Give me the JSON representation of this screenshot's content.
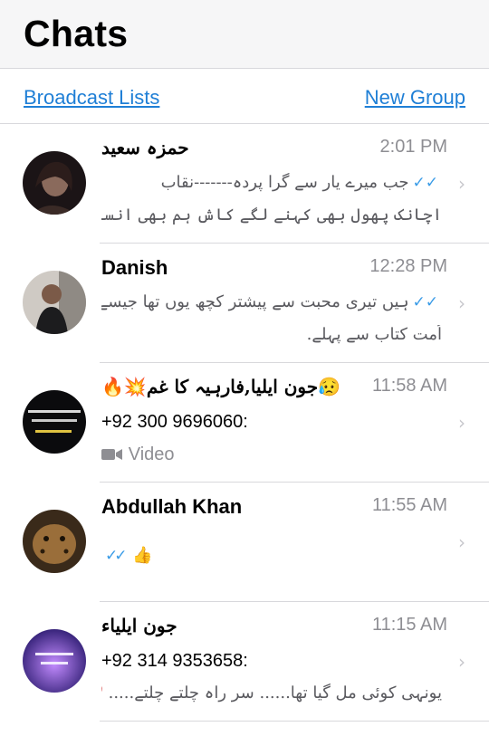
{
  "header": {
    "title": "Chats"
  },
  "actions": {
    "broadcast": "Broadcast Lists",
    "new_group": "New Group"
  },
  "chats": [
    {
      "name": "حمزہ سعید",
      "time": "2:01 PM",
      "read_ticks": "✓✓",
      "line1": "جب میرے یار سے گرا پردہ-------نقاب",
      "line2": "اچانک پھول بھی کہنے لگے کاش ہم بھی انسان ہوتے..."
    },
    {
      "name": "Danish",
      "time": "12:28 PM",
      "read_ticks": "✓✓",
      "line1": "ہیں تیری محبت سے پیشتر کچھ یوں تھا جیسے کوئی",
      "line2": "اُمت کتاب سے پہلے."
    },
    {
      "name": "🔥💥جون ایلیا,فارہیہ کا غم😥",
      "time": "11:58 AM",
      "sender": "+92 300 9696060:",
      "attachment_icon": "video-camera-icon",
      "attachment_label": "Video"
    },
    {
      "name": "Abdullah Khan",
      "time": "11:55 AM",
      "read_ticks": "✓✓",
      "emoji": "👍"
    },
    {
      "name": "جون ایلیاء",
      "time": "11:15 AM",
      "sender": "+92 314 9353658:",
      "line1": "یونہی کوئی مل گیا تھا...... سرِ راہ چلتے چلتے.....",
      "emoji": "❤️"
    }
  ],
  "colors": {
    "accent": "#1f7fd6",
    "ticks": "#3b9ce7",
    "secondary": "#8e8e93",
    "divider": "#d8d8dc"
  }
}
